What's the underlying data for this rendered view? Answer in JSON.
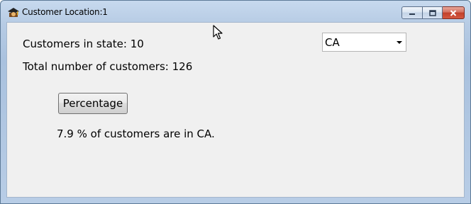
{
  "window": {
    "title": "Customer Location:1",
    "icon": "app-icon"
  },
  "caption_buttons": {
    "minimize_icon": "minimize-icon",
    "maximize_icon": "maximize-icon",
    "close_icon": "close-icon"
  },
  "main": {
    "customers_in_state": "Customers in state: 10",
    "total_customers": "Total number of customers: 126",
    "percentage_button_label": "Percentage",
    "result_text": "7.9 % of customers are in CA."
  },
  "state_select": {
    "selected": "CA",
    "icon": "chevron-down-icon"
  },
  "colors": {
    "client_background": "#f0f0f0",
    "titlebar": "#b6cbe4",
    "close_button": "#c1412b"
  }
}
